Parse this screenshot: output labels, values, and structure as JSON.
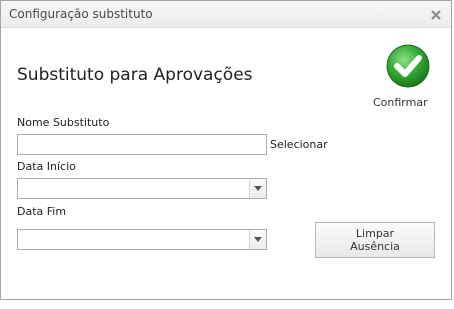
{
  "window": {
    "title": "Configuração substituto",
    "close_icon": "close-icon"
  },
  "header": {
    "heading": "Substituto para Aprovações",
    "confirm_label": "Confirmar",
    "confirm_icon": "check-circle-icon",
    "confirm_color": "#2e9e2e"
  },
  "form": {
    "substitute_label": "Nome Substituto",
    "substitute_value": "",
    "select_label": "Selecionar",
    "start_date_label": "Data Início",
    "start_date_value": "",
    "end_date_label": "Data Fim",
    "end_date_value": "",
    "dropdown_icon": "chevron-down-icon"
  },
  "actions": {
    "clear_line1": "Limpar",
    "clear_line2": "Ausência"
  }
}
